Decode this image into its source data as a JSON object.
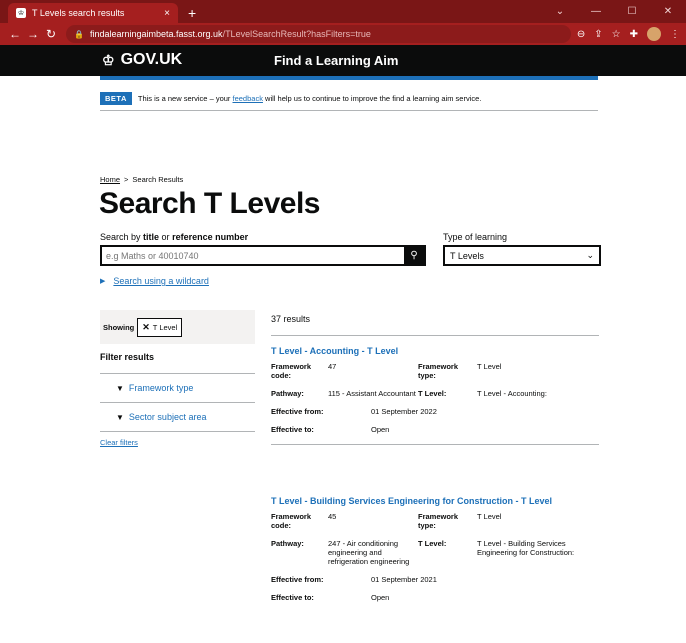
{
  "browser": {
    "tab_title": "T Levels search results",
    "tab_close": "×",
    "new_tab": "+",
    "url_domain": "findalearningaimbeta.fasst.org.uk",
    "url_path": "/TLevelSearchResult?hasFilters=true"
  },
  "header": {
    "logo_text": "GOV.UK",
    "service_name": "Find a Learning Aim"
  },
  "beta": {
    "tag": "BETA",
    "text_before": "This is a new service – your ",
    "link": "feedback",
    "text_after": " will help us to continue to improve the find a learning aim service."
  },
  "breadcrumb": {
    "home": "Home",
    "separator": ">",
    "current": "Search Results"
  },
  "page_title": "Search T Levels",
  "search": {
    "label_prefix": "Search by ",
    "label_title": "title",
    "label_or": " or ",
    "label_ref": "reference number",
    "placeholder": "e.g Maths or 40010740"
  },
  "type_of_learning": {
    "label": "Type of learning",
    "selected": "T Levels"
  },
  "wildcard_link": "Search using a wildcard",
  "filters": {
    "showing_label": "Showing",
    "chip": "T Level",
    "heading": "Filter results",
    "sections": [
      "Framework type",
      "Sector subject area"
    ],
    "clear": "Clear filters"
  },
  "results_count": "37 results",
  "results": [
    {
      "title": "T Level - Accounting - T Level",
      "framework_code_label": "Framework code:",
      "framework_code": "47",
      "framework_type_label": "Framework type:",
      "framework_type": "T Level",
      "pathway_label": "Pathway:",
      "pathway": "115 - Assistant Accountant",
      "tlevel_label": "T Level:",
      "tlevel": "T Level - Accounting:",
      "effective_from_label": "Effective from:",
      "effective_from": "01 September 2022",
      "effective_to_label": "Effective to:",
      "effective_to": "Open"
    },
    {
      "title": "T Level - Building Services Engineering for Construction - T Level",
      "framework_code_label": "Framework code:",
      "framework_code": "45",
      "framework_type_label": "Framework type:",
      "framework_type": "T Level",
      "pathway_label": "Pathway:",
      "pathway": "247 - Air conditioning engineering and refrigeration engineering",
      "tlevel_label": "T Level:",
      "tlevel": "T Level - Building Services Engineering for Construction:",
      "effective_from_label": "Effective from:",
      "effective_from": "01 September 2021",
      "effective_to_label": "Effective to:",
      "effective_to": "Open"
    }
  ]
}
